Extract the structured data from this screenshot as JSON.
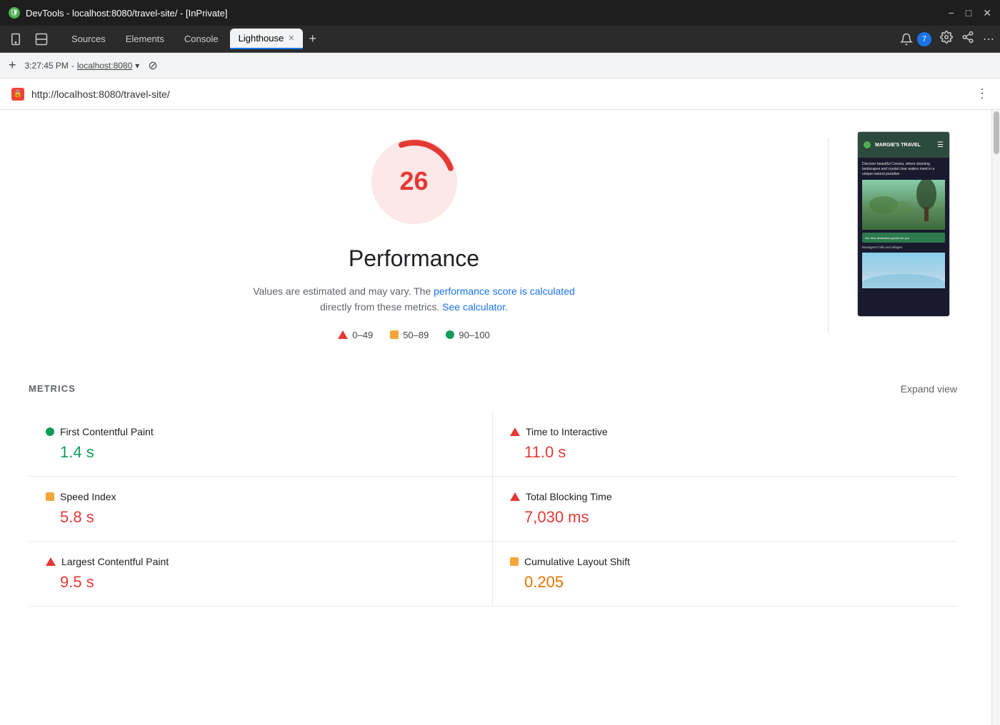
{
  "titleBar": {
    "icon": "🛡",
    "title": "DevTools - localhost:8080/travel-site/ - [InPrivate]",
    "minimize": "−",
    "restore": "□",
    "close": "✕"
  },
  "tabBar": {
    "tabs": [
      {
        "id": "sources",
        "label": "Sources",
        "active": false
      },
      {
        "id": "elements",
        "label": "Elements",
        "active": false
      },
      {
        "id": "console",
        "label": "Console",
        "active": false
      },
      {
        "id": "lighthouse",
        "label": "Lighthouse",
        "active": true
      }
    ],
    "notifications": "7",
    "addTab": "+"
  },
  "addressBar": {
    "time": "3:27:45 PM",
    "host": "localhost:8080",
    "dropdownIcon": "▾"
  },
  "urlBar": {
    "url": "http://localhost:8080/travel-site/",
    "moreIcon": "⋮"
  },
  "performance": {
    "score": "26",
    "title": "Performance",
    "description1": "Values are estimated and may vary. The ",
    "link1": "performance score is calculated",
    "description2": " directly from these metrics. ",
    "link2": "See calculator.",
    "legend": {
      "poor": "0–49",
      "needsImprovement": "50–89",
      "good": "90–100"
    }
  },
  "metrics": {
    "sectionLabel": "METRICS",
    "expandView": "Expand view",
    "items": [
      {
        "id": "fcp",
        "indicator": "green",
        "name": "First Contentful Paint",
        "value": "1.4 s",
        "color": "green"
      },
      {
        "id": "tti",
        "indicator": "red",
        "name": "Time to Interactive",
        "value": "11.0 s",
        "color": "red"
      },
      {
        "id": "si",
        "indicator": "orange",
        "name": "Speed Index",
        "value": "5.8 s",
        "color": "red"
      },
      {
        "id": "tbt",
        "indicator": "red",
        "name": "Total Blocking Time",
        "value": "7,030 ms",
        "color": "red"
      },
      {
        "id": "lcp",
        "indicator": "red",
        "name": "Largest Contentful Paint",
        "value": "9.5 s",
        "color": "red"
      },
      {
        "id": "cls",
        "indicator": "orange",
        "name": "Cumulative Layout Shift",
        "value": "0.205",
        "color": "orange"
      }
    ]
  },
  "screenshot": {
    "title": "MARGIE'S TRAVEL",
    "tagline": "Discover beautiful Corsica, where stunning landscapes and crystal clear waters meet in a unique natural paradise",
    "caption": "Our best destination guides for you",
    "subcaption": "Bastagne's hills and villages"
  }
}
